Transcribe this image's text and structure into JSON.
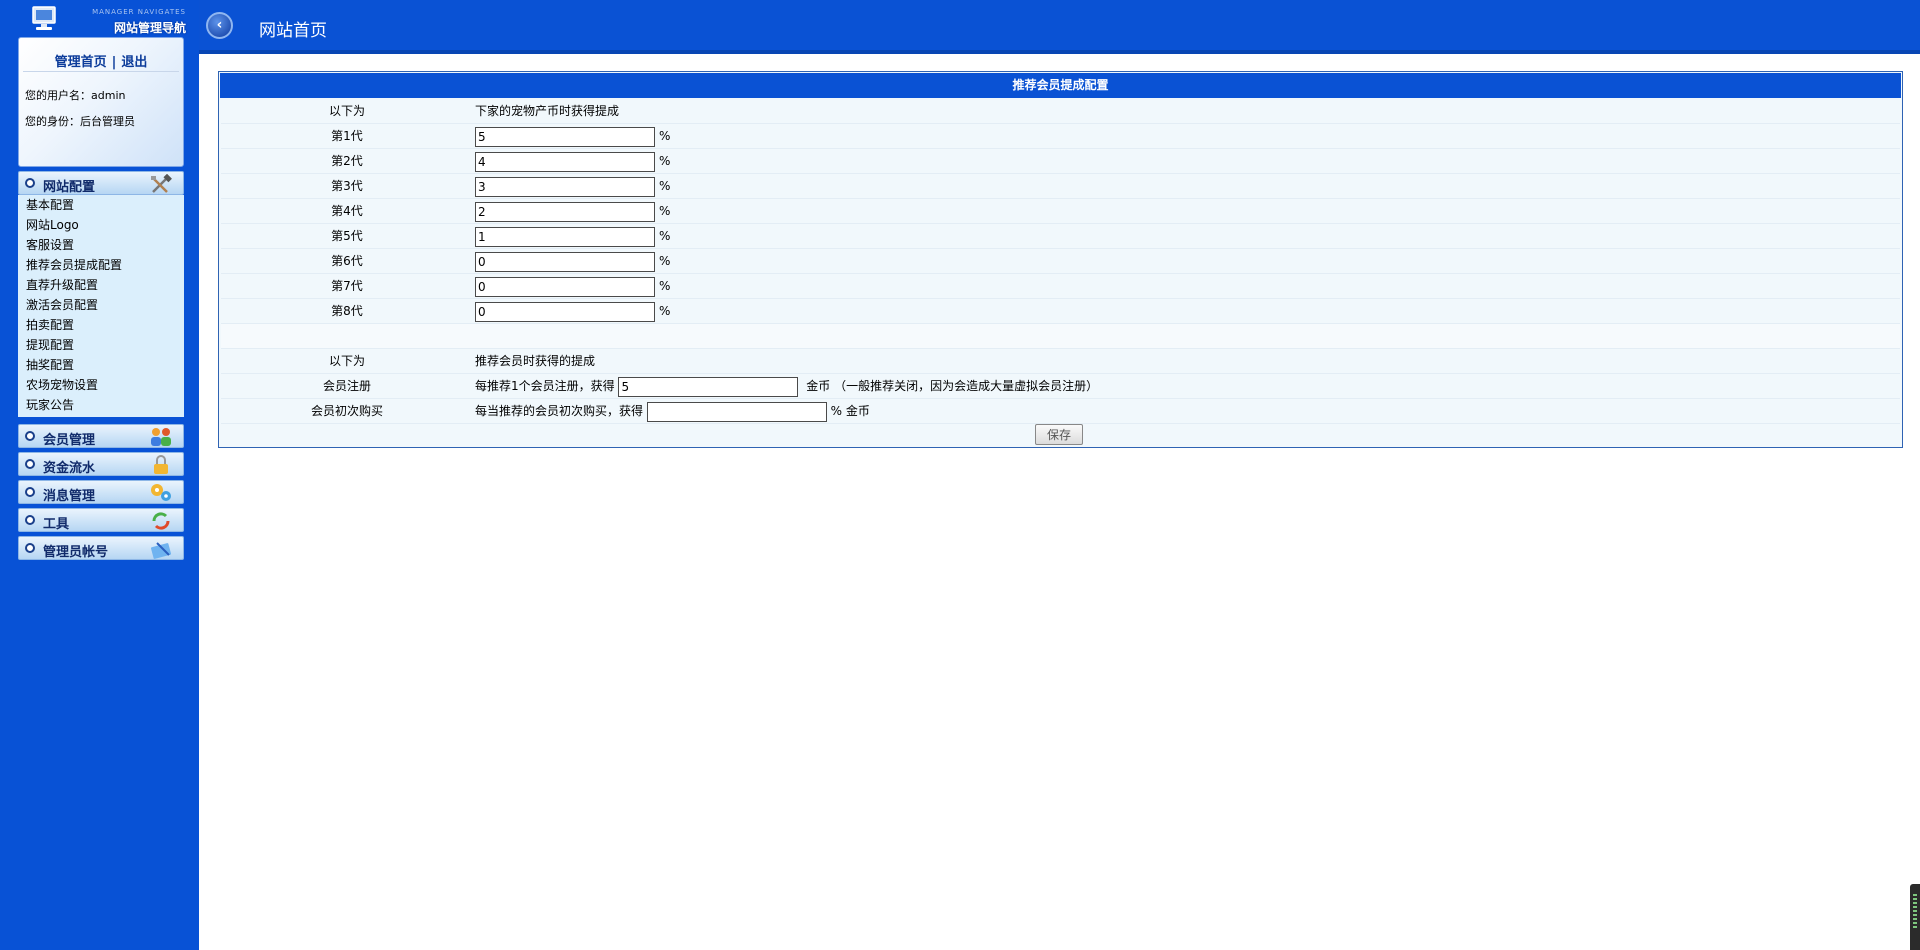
{
  "app": {
    "logo_subtitle": "MANAGER NAVIGATES",
    "logo_title": "网站管理导航"
  },
  "user_panel": {
    "home_link": "管理首页",
    "separator": "|",
    "logout_link": "退出",
    "username_line": "您的用户名：admin",
    "role_line": "您的身份：后台管理员"
  },
  "sidebar": {
    "active_section": {
      "label": "网站配置",
      "icon": "tools-icon",
      "items": [
        {
          "label": "基本配置"
        },
        {
          "label": "网站Logo"
        },
        {
          "label": "客服设置"
        },
        {
          "label": "推荐会员提成配置"
        },
        {
          "label": "直荐升级配置"
        },
        {
          "label": "激活会员配置"
        },
        {
          "label": "拍卖配置"
        },
        {
          "label": "提现配置"
        },
        {
          "label": "抽奖配置"
        },
        {
          "label": "农场宠物设置"
        },
        {
          "label": "玩家公告"
        }
      ]
    },
    "sections": [
      {
        "label": "会员管理",
        "icon": "users-icon"
      },
      {
        "label": "资金流水",
        "icon": "lock-icon"
      },
      {
        "label": "消息管理",
        "icon": "message-gear-icon"
      },
      {
        "label": "工具",
        "icon": "recycle-icon"
      },
      {
        "label": "管理员帐号",
        "icon": "admin-account-icon"
      }
    ]
  },
  "header": {
    "title": "网站首页",
    "back_icon": "back-arrow-icon"
  },
  "form": {
    "caption": "推荐会员提成配置",
    "section1": {
      "label": "以下为",
      "desc": "下家的宠物产币时获得提成"
    },
    "generations": [
      {
        "label": "第1代",
        "value": "5",
        "unit": "%"
      },
      {
        "label": "第2代",
        "value": "4",
        "unit": "%"
      },
      {
        "label": "第3代",
        "value": "3",
        "unit": "%"
      },
      {
        "label": "第4代",
        "value": "2",
        "unit": "%"
      },
      {
        "label": "第5代",
        "value": "1",
        "unit": "%"
      },
      {
        "label": "第6代",
        "value": "0",
        "unit": "%"
      },
      {
        "label": "第7代",
        "value": "0",
        "unit": "%"
      },
      {
        "label": "第8代",
        "value": "0",
        "unit": "%"
      }
    ],
    "section2": {
      "label": "以下为",
      "desc": "推荐会员时获得的提成"
    },
    "register": {
      "label": "会员注册",
      "prefix": "每推荐1个会员注册，获得",
      "value": "5",
      "suffix": "金币 （一般推荐关闭，因为会造成大量虚拟会员注册）"
    },
    "first_purchase": {
      "label": "会员初次购买",
      "prefix": "每当推荐的会员初次购买，获得",
      "value": "",
      "suffix": "% 金币"
    },
    "save_label": "保存"
  }
}
